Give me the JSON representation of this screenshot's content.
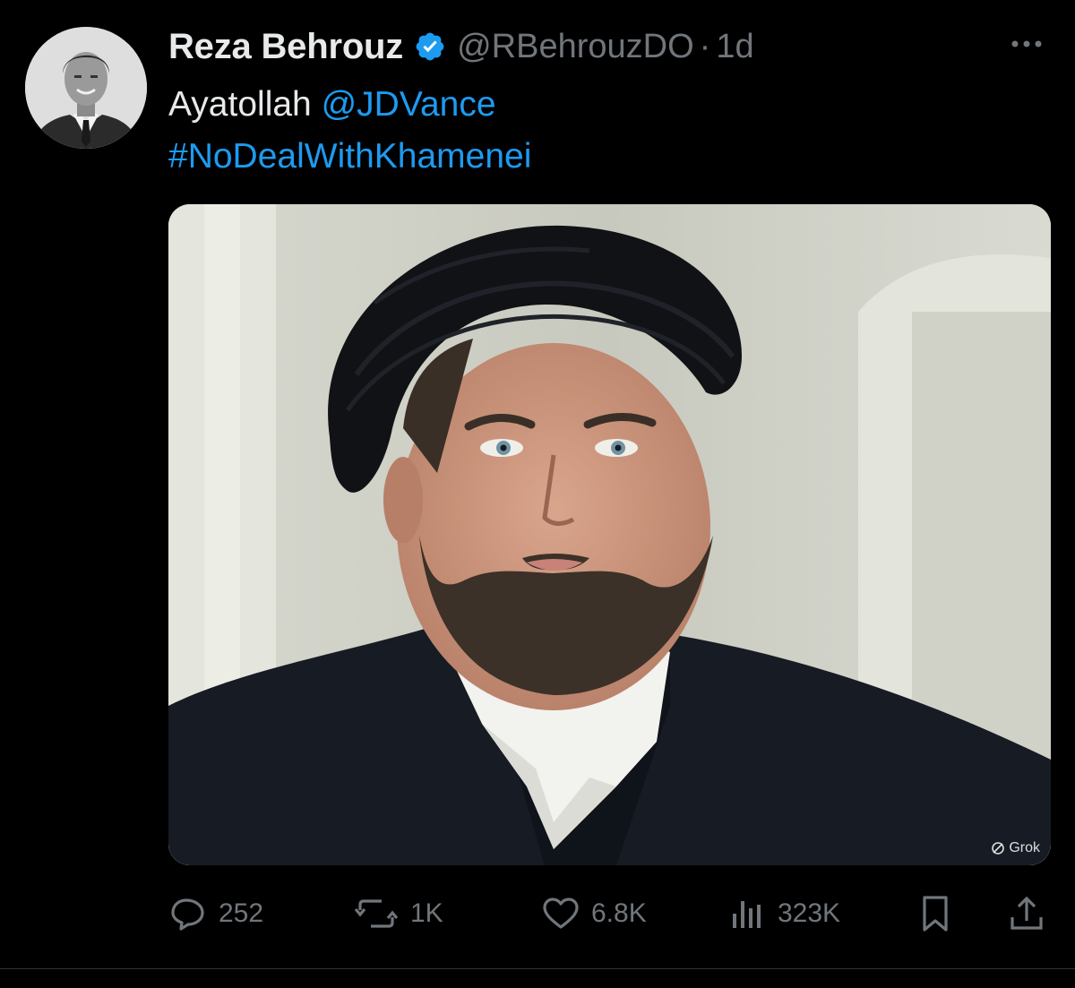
{
  "post": {
    "author": {
      "display_name": "Reza Behrouz",
      "handle": "@RBehrouzDO",
      "verified": true,
      "avatar_icon": "profile-photo"
    },
    "separator": "·",
    "timestamp": "1d",
    "text": {
      "prefix": "Ayatollah ",
      "mention": "@JDVance",
      "hashtag": "#NoDealWithKhamenei"
    },
    "media": {
      "watermark": "Grok"
    },
    "actions": {
      "replies": "252",
      "reposts": "1K",
      "likes": "6.8K",
      "views": "323K"
    }
  },
  "colors": {
    "background": "#000000",
    "text": "#e7e9ea",
    "muted": "#71767b",
    "link": "#1d9bf0",
    "verified_badge": "#1d9bf0",
    "divider": "#2f3336"
  }
}
